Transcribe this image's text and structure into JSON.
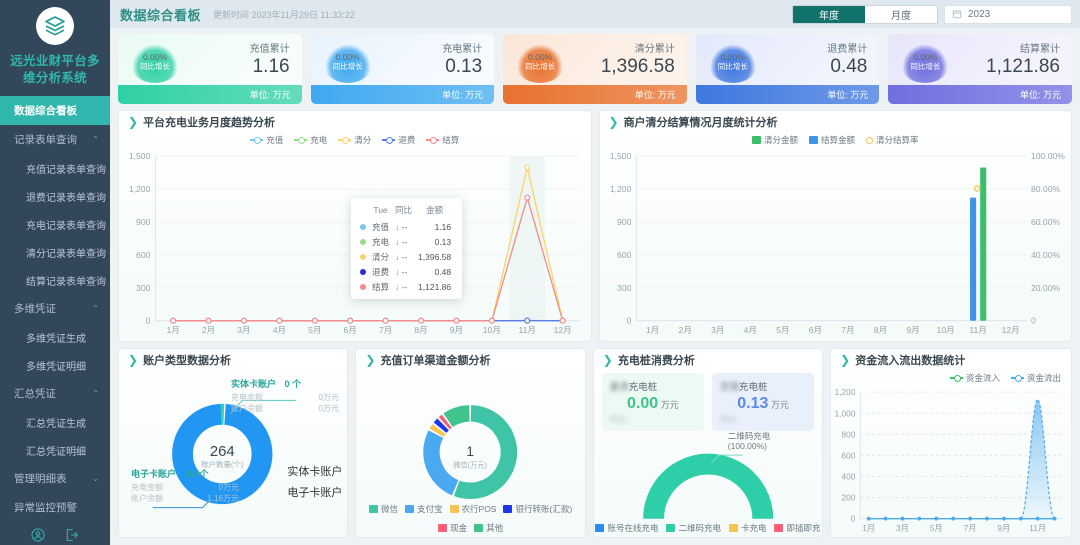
{
  "sidebar": {
    "brand_line1": "远光业财平台多",
    "brand_line2": "维分析系统",
    "logo_icon": "layers-icon",
    "items": [
      {
        "label": "数据综合看板",
        "type": "active"
      },
      {
        "label": "记录表单查询",
        "type": "group",
        "caret": "⌃"
      },
      {
        "label": "充值记录表单查询",
        "type": "sub"
      },
      {
        "label": "退费记录表单查询",
        "type": "sub"
      },
      {
        "label": "充电记录表单查询",
        "type": "sub"
      },
      {
        "label": "清分记录表单查询",
        "type": "sub"
      },
      {
        "label": "结算记录表单查询",
        "type": "sub"
      },
      {
        "label": "多维凭证",
        "type": "group",
        "caret": "⌃"
      },
      {
        "label": "多维凭证生成",
        "type": "sub"
      },
      {
        "label": "多维凭证明细",
        "type": "sub"
      },
      {
        "label": "汇总凭证",
        "type": "group",
        "caret": "⌃"
      },
      {
        "label": "汇总凭证生成",
        "type": "sub"
      },
      {
        "label": "汇总凭证明细",
        "type": "sub"
      },
      {
        "label": "管理明细表",
        "type": "group",
        "caret": "⌄"
      },
      {
        "label": "异常监控预警",
        "type": "group"
      }
    ],
    "footer_icons": [
      "user-icon",
      "logout-icon"
    ]
  },
  "header": {
    "title": "数据综合看板",
    "update_time": "更新时间 2023年11月29日 11:33:22",
    "tabs": [
      {
        "label": "年度",
        "active": true
      },
      {
        "label": "月度",
        "active": false
      }
    ],
    "date_value": "2023",
    "date_icon": "calendar-icon"
  },
  "kpis": [
    {
      "pct": "0.00%",
      "badge": "同比增长",
      "name": "充值累计",
      "value": "1.16",
      "unit": "单位: 万元",
      "accent": "#2fd0a5",
      "bg1": "#eafbf4",
      "bg2": "#f6fdfa"
    },
    {
      "pct": "0.00%",
      "badge": "同比增长",
      "name": "充电累计",
      "value": "0.13",
      "unit": "单位: 万元",
      "accent": "#3fa9f0",
      "bg1": "#e8f3fd",
      "bg2": "#f5fafe"
    },
    {
      "pct": "0.00%",
      "badge": "同比增长",
      "name": "清分累计",
      "value": "1,396.58",
      "unit": "单位: 万元",
      "accent": "#e8722f",
      "bg1": "#fae6d8",
      "bg2": "#fdf2ea"
    },
    {
      "pct": "0.00%",
      "badge": "同比增长",
      "name": "退费累计",
      "value": "0.48",
      "unit": "单位: 万元",
      "accent": "#3f78e0",
      "bg1": "#e3e9fb",
      "bg2": "#f1f4fd"
    },
    {
      "pct": "0.00%",
      "badge": "同比增长",
      "name": "结算累计",
      "value": "1,121.86",
      "unit": "单位: 万元",
      "accent": "#6f6fe0",
      "bg1": "#e7e6fa",
      "bg2": "#f3f2fd"
    }
  ],
  "panels": {
    "trend": {
      "title": "平台充电业务月度趋势分析"
    },
    "merchant": {
      "title": "商户清分结算情况月度统计分析"
    },
    "account": {
      "title": "账户类型数据分析"
    },
    "channel": {
      "title": "充值订单渠道金额分析"
    },
    "pile": {
      "title": "充电桩消费分析"
    },
    "flow": {
      "title": "资金流入流出数据统计"
    }
  },
  "pile_stats": [
    {
      "prefix": "直流",
      "name": "充电桩",
      "value": "0.00",
      "unit": "万元",
      "compare": "同比-",
      "color": "#3cc48c",
      "bg": "#edf9f3"
    },
    {
      "prefix": "交流",
      "name": "充电桩",
      "value": "0.13",
      "unit": "万元",
      "compare": "同比-",
      "color": "#5a8be8",
      "bg": "#eaf0fb"
    }
  ],
  "account_detail": {
    "solid": {
      "name": "实体卡账户",
      "count": "0 个",
      "rows": [
        [
          "充电金额",
          "0万元"
        ],
        [
          "账户余额",
          "0万元"
        ]
      ]
    },
    "electronic": {
      "name": "电子卡账户",
      "count": "264个",
      "rows": [
        [
          "充电金额",
          "0万元"
        ],
        [
          "账户余额",
          "1.16万元"
        ]
      ]
    },
    "center_value": "264",
    "center_label": "账户数量(个)",
    "legend": [
      {
        "label": "实体卡账户",
        "color": "#2ad4b0"
      },
      {
        "label": "电子卡账户",
        "color": "#2196f3"
      }
    ]
  },
  "gauge": {
    "label": "二维码充电",
    "value": "(100.00%)",
    "legend": [
      {
        "label": "账号在线充电",
        "color": "#2b8cf0"
      },
      {
        "label": "二维码充电",
        "color": "#2ecfa8"
      },
      {
        "label": "卡充电",
        "color": "#f7c453"
      },
      {
        "label": "即插即充",
        "color": "#f4607a"
      }
    ]
  },
  "tooltip": {
    "col_day": "Tue",
    "col_yoy": "同比",
    "col_amount": "金额",
    "arrow": "↓",
    "rows": [
      {
        "color": "#73c9ee",
        "name": "充值",
        "yoy": "--",
        "amount": "1.16"
      },
      {
        "color": "#97de8c",
        "name": "充电",
        "yoy": "--",
        "amount": "0.13"
      },
      {
        "color": "#fbd36b",
        "name": "清分",
        "yoy": "--",
        "amount": "1,396.58"
      },
      {
        "color": "#2b2be0",
        "name": "退费",
        "yoy": "--",
        "amount": "0.48"
      },
      {
        "color": "#f98a8a",
        "name": "结算",
        "yoy": "--",
        "amount": "1,121.86"
      }
    ]
  },
  "chart_data": [
    {
      "id": "trend",
      "type": "line",
      "title": "平台充电业务月度趋势分析",
      "categories": [
        "1月",
        "2月",
        "3月",
        "4月",
        "5月",
        "6月",
        "7月",
        "8月",
        "9月",
        "10月",
        "11月",
        "12月"
      ],
      "yticks": [
        "0",
        "300",
        "600",
        "900",
        "1,200",
        "1,500"
      ],
      "ylim": [
        0,
        1500
      ],
      "grid": true,
      "legend_position": "top",
      "series": [
        {
          "name": "充值",
          "color": "#73c9ee",
          "values": [
            0,
            0,
            0,
            0,
            0,
            0,
            0,
            0,
            0,
            0,
            1.16,
            0
          ]
        },
        {
          "name": "充电",
          "color": "#97de8c",
          "values": [
            0,
            0,
            0,
            0,
            0,
            0,
            0,
            0,
            0,
            0,
            0.13,
            0
          ]
        },
        {
          "name": "清分",
          "color": "#fbd36b",
          "values": [
            0,
            0,
            0,
            0,
            0,
            0,
            0,
            0,
            0,
            0,
            1396.58,
            0
          ]
        },
        {
          "name": "退费",
          "color": "#5b7ce8",
          "values": [
            0,
            0,
            0,
            0,
            0,
            0,
            0,
            0,
            0,
            0,
            0.48,
            0
          ]
        },
        {
          "name": "结算",
          "color": "#f98a8a",
          "values": [
            0,
            0,
            0,
            0,
            0,
            0,
            0,
            0,
            0,
            0,
            1121.86,
            0
          ]
        }
      ]
    },
    {
      "id": "merchant",
      "type": "bar",
      "title": "商户清分结算情况月度统计分析",
      "categories": [
        "1月",
        "2月",
        "3月",
        "4月",
        "5月",
        "6月",
        "7月",
        "8月",
        "9月",
        "10月",
        "11月",
        "12月"
      ],
      "yticks": [
        "0",
        "300",
        "600",
        "900",
        "1,200",
        "1,500"
      ],
      "y2ticks": [
        "0",
        "20.00%",
        "40.00%",
        "60.00%",
        "80.00%",
        "100.00%"
      ],
      "ylim": [
        0,
        1500
      ],
      "y2lim": [
        0,
        100
      ],
      "grid": true,
      "legend_position": "top",
      "series": [
        {
          "name": "清分金额",
          "type": "bar",
          "color": "#3cbf6b",
          "values": [
            0,
            0,
            0,
            0,
            0,
            0,
            0,
            0,
            0,
            0,
            1396.58,
            0
          ]
        },
        {
          "name": "结算金额",
          "type": "bar",
          "color": "#3b93ea",
          "values": [
            0,
            0,
            0,
            0,
            0,
            0,
            0,
            0,
            0,
            0,
            1121.86,
            0
          ]
        },
        {
          "name": "清分结算率",
          "type": "line",
          "color": "#f7c35a",
          "values": [
            null,
            null,
            null,
            null,
            null,
            null,
            null,
            null,
            null,
            null,
            80.33,
            null
          ]
        }
      ]
    },
    {
      "id": "account",
      "type": "pie",
      "title": "账户类型数据分析",
      "labels": [
        "实体卡账户",
        "电子卡账户"
      ],
      "values": [
        0,
        264
      ],
      "colors": [
        "#2ad4b0",
        "#2196f3"
      ],
      "center_value": "264",
      "center_label": "账户数量(个)"
    },
    {
      "id": "channel",
      "type": "pie",
      "title": "充值订单渠道金额分析",
      "labels": [
        "微信",
        "支付宝",
        "农行POS",
        "银行转账(汇款)",
        "现金",
        "其他"
      ],
      "values": [
        56,
        27,
        2.5,
        2.5,
        2,
        10
      ],
      "colors": [
        "#3fc4a8",
        "#4aa9f0",
        "#f7c453",
        "#1b36e8",
        "#f4607a",
        "#3fc48c"
      ],
      "center_value": "1",
      "center_label": "微信(万元)"
    },
    {
      "id": "pile",
      "type": "pie",
      "title": "充电桩消费分析",
      "labels": [
        "账号在线充电",
        "二维码充电",
        "卡充电",
        "即插即充"
      ],
      "values": [
        0,
        100,
        0,
        0
      ],
      "colors": [
        "#2b8cf0",
        "#2ecfa8",
        "#f7c453",
        "#f4607a"
      ],
      "annotation": "二维码充电 (100.00%)"
    },
    {
      "id": "flow",
      "type": "area",
      "title": "资金流入流出数据统计",
      "categories": [
        "1月",
        "2月",
        "3月",
        "4月",
        "5月",
        "6月",
        "7月",
        "8月",
        "9月",
        "10月",
        "11月",
        "12月"
      ],
      "xticklabels": [
        "1月",
        "3月",
        "5月",
        "7月",
        "9月",
        "11月"
      ],
      "yticks": [
        "0",
        "200",
        "400",
        "600",
        "800",
        "1,000",
        "1,200"
      ],
      "ylim": [
        0,
        1200
      ],
      "grid": true,
      "legend_position": "top-right",
      "series": [
        {
          "name": "资金流入",
          "color": "#3cbf6b",
          "values": [
            0,
            0,
            0,
            0,
            0,
            0,
            0,
            0,
            0,
            0,
            0,
            0
          ]
        },
        {
          "name": "资金流出",
          "color": "#4aa9f0",
          "values": [
            0,
            0,
            0,
            0,
            0,
            0,
            0,
            0,
            0,
            0,
            1130,
            0
          ]
        }
      ]
    }
  ]
}
